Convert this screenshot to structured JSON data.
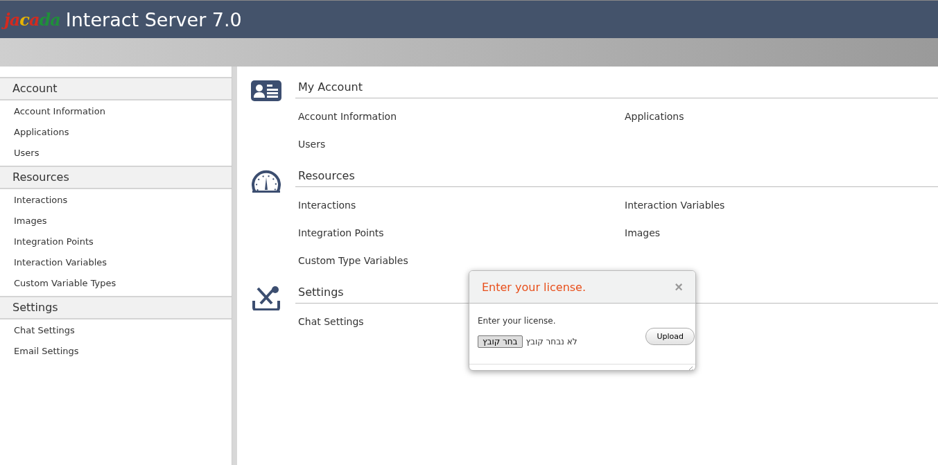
{
  "header": {
    "logo": "jacada",
    "title": "Interact Server 7.0"
  },
  "sidebar": {
    "groups": [
      {
        "title": "Account",
        "items": [
          "Account Information",
          "Applications",
          "Users"
        ]
      },
      {
        "title": "Resources",
        "items": [
          "Interactions",
          "Images",
          "Integration Points",
          "Interaction Variables",
          "Custom Variable Types"
        ]
      },
      {
        "title": "Settings",
        "items": [
          "Chat Settings",
          "Email Settings"
        ]
      }
    ]
  },
  "sections": [
    {
      "kind": "account",
      "title": "My Account",
      "items": [
        "Account Information",
        "Applications",
        "Users"
      ]
    },
    {
      "kind": "resources",
      "title": "Resources",
      "items": [
        "Interactions",
        "Interaction Variables",
        "Integration Points",
        "Images",
        "Custom Type Variables"
      ]
    },
    {
      "kind": "settings",
      "title": "Settings",
      "items": [
        "Chat Settings"
      ]
    }
  ],
  "dialog": {
    "title": "Enter your license.",
    "close": "×",
    "message": "Enter your license.",
    "file_button": "בחר קובץ",
    "file_status": "לא נבחר קובץ",
    "upload_button": "Upload"
  }
}
